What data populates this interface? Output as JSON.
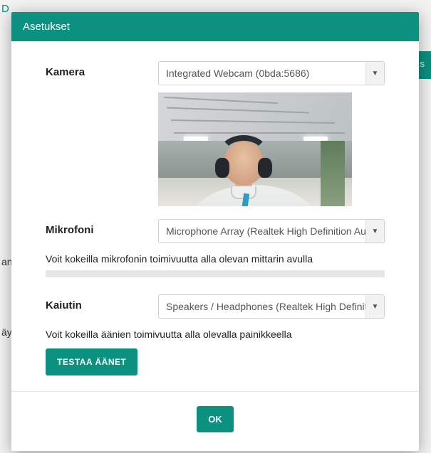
{
  "modal": {
    "title": "Asetukset",
    "ok_label": "OK"
  },
  "camera": {
    "label": "Kamera",
    "selected": "Integrated Webcam (0bda:5686)"
  },
  "microphone": {
    "label": "Mikrofoni",
    "selected": "Microphone Array (Realtek High Definition Audio)",
    "help_text": "Voit kokeilla mikrofonin toimivuutta alla olevan mittarin avulla"
  },
  "speaker": {
    "label": "Kaiutin",
    "selected": "Speakers / Headphones (Realtek High Definition Audio)",
    "help_text": "Voit kokeilla äänien toimivuutta alla olevalla painikkeella",
    "test_button_label": "TESTAA ÄÄNET"
  },
  "background": {
    "top_left": "D",
    "mid_left_1": "an",
    "mid_left_2": "äy",
    "right_btn": "ES"
  }
}
